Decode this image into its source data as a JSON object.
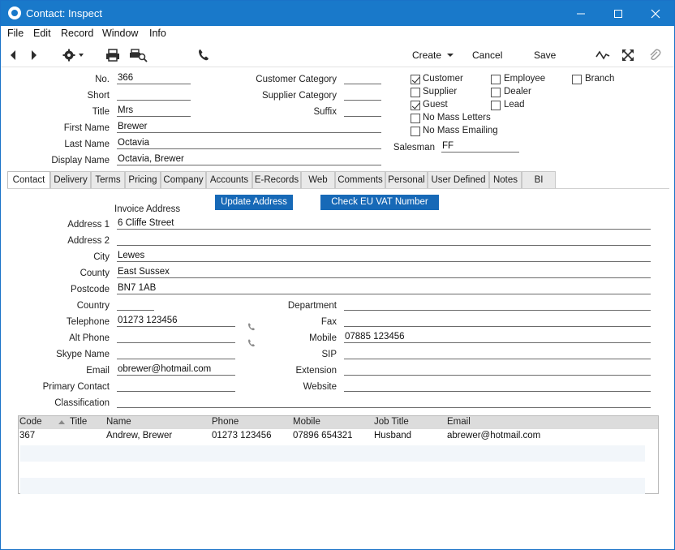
{
  "window": {
    "title": "Contact: Inspect"
  },
  "menu": [
    "File",
    "Edit",
    "Record",
    "Window",
    "Info"
  ],
  "toolbar": {
    "create_label": "Create",
    "cancel_label": "Cancel",
    "save_label": "Save"
  },
  "header": {
    "no_label": "No.",
    "no_value": "366",
    "short_label": "Short",
    "short_value": "",
    "title_label": "Title",
    "title_value": "Mrs",
    "first_name_label": "First Name",
    "first_name_value": "Brewer",
    "last_name_label": "Last Name",
    "last_name_value": "Octavia",
    "display_name_label": "Display Name",
    "display_name_value": "Octavia, Brewer",
    "customer_category_label": "Customer Category",
    "customer_category_value": "",
    "supplier_category_label": "Supplier Category",
    "supplier_category_value": "",
    "suffix_label": "Suffix",
    "suffix_value": "",
    "salesman_label": "Salesman",
    "salesman_value": "FF"
  },
  "checkboxes": {
    "customer": {
      "label": "Customer",
      "checked": true
    },
    "supplier": {
      "label": "Supplier",
      "checked": false
    },
    "guest": {
      "label": "Guest",
      "checked": true
    },
    "no_mass_letters": {
      "label": "No Mass Letters",
      "checked": false
    },
    "no_mass_emailing": {
      "label": "No Mass Emailing",
      "checked": false
    },
    "employee": {
      "label": "Employee",
      "checked": false
    },
    "dealer": {
      "label": "Dealer",
      "checked": false
    },
    "lead": {
      "label": "Lead",
      "checked": false
    },
    "branch": {
      "label": "Branch",
      "checked": false
    }
  },
  "tabs": [
    "Contact",
    "Delivery",
    "Terms",
    "Pricing",
    "Company",
    "Accounts",
    "E-Records",
    "Web",
    "Comments",
    "Personal",
    "User Defined",
    "Notes",
    "BI"
  ],
  "contact": {
    "update_address_label": "Update Address",
    "check_vat_label": "Check EU VAT Number",
    "invoice_address_label": "Invoice Address",
    "address1_label": "Address 1",
    "address1_value": "6 Cliffe Street",
    "address2_label": "Address 2",
    "address2_value": "",
    "city_label": "City",
    "city_value": "Lewes",
    "county_label": "County",
    "county_value": "East Sussex",
    "postcode_label": "Postcode",
    "postcode_value": "BN7 1AB",
    "country_label": "Country",
    "country_value": "",
    "telephone_label": "Telephone",
    "telephone_value": "01273 123456",
    "alt_phone_label": "Alt Phone",
    "alt_phone_value": "",
    "skype_label": "Skype Name",
    "skype_value": "",
    "email_label": "Email",
    "email_value": "obrewer@hotmail.com",
    "primary_contact_label": "Primary Contact",
    "primary_contact_value": "",
    "classification_label": "Classification",
    "classification_value": "",
    "department_label": "Department",
    "department_value": "",
    "fax_label": "Fax",
    "fax_value": "",
    "mobile_label": "Mobile",
    "mobile_value": "07885 123456",
    "sip_label": "SIP",
    "sip_value": "",
    "extension_label": "Extension",
    "extension_value": "",
    "website_label": "Website",
    "website_value": ""
  },
  "grid": {
    "columns": [
      "Code",
      "Title",
      "Name",
      "Phone",
      "Mobile",
      "Job Title",
      "Email"
    ],
    "rows": [
      {
        "code": "367",
        "title": "",
        "name": "Andrew, Brewer",
        "phone": "01273 123456",
        "mobile": "07896 654321",
        "job_title": "Husband",
        "email": "abrewer@hotmail.com"
      }
    ]
  },
  "icons": {
    "prev": "arrow-left-icon",
    "next": "arrow-right-icon",
    "settings": "gear-icon",
    "print": "printer-icon",
    "preview": "print-preview-icon",
    "call": "phone-icon",
    "activity": "activity-icon",
    "fullscreen": "fullscreen-icon",
    "attach": "paperclip-icon"
  },
  "colors": {
    "titlebar": "#1979ca",
    "button": "#1769b7"
  }
}
